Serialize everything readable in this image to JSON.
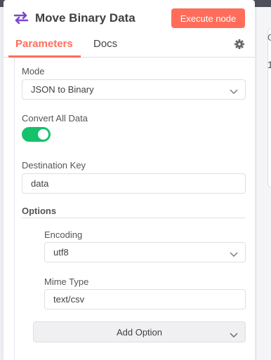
{
  "node": {
    "title": "Move Binary Data",
    "execute_label": "Execute node"
  },
  "tabs": [
    {
      "label": "Parameters",
      "active": true
    },
    {
      "label": "Docs",
      "active": false
    }
  ],
  "params": {
    "mode_label": "Mode",
    "mode_value": "JSON to Binary",
    "convert_all_label": "Convert All Data",
    "convert_all_on": true,
    "dest_key_label": "Destination Key",
    "dest_key_value": "data",
    "options_label": "Options",
    "encoding_label": "Encoding",
    "encoding_value": "utf8",
    "mime_label": "Mime Type",
    "mime_value": "text/csv",
    "add_option_label": "Add Option"
  },
  "background": {
    "text1": "O",
    "text2": "1"
  },
  "colors": {
    "accent": "#ff6d5a",
    "toggle_on": "#13c26a",
    "node_icon": "#7b46ce"
  }
}
